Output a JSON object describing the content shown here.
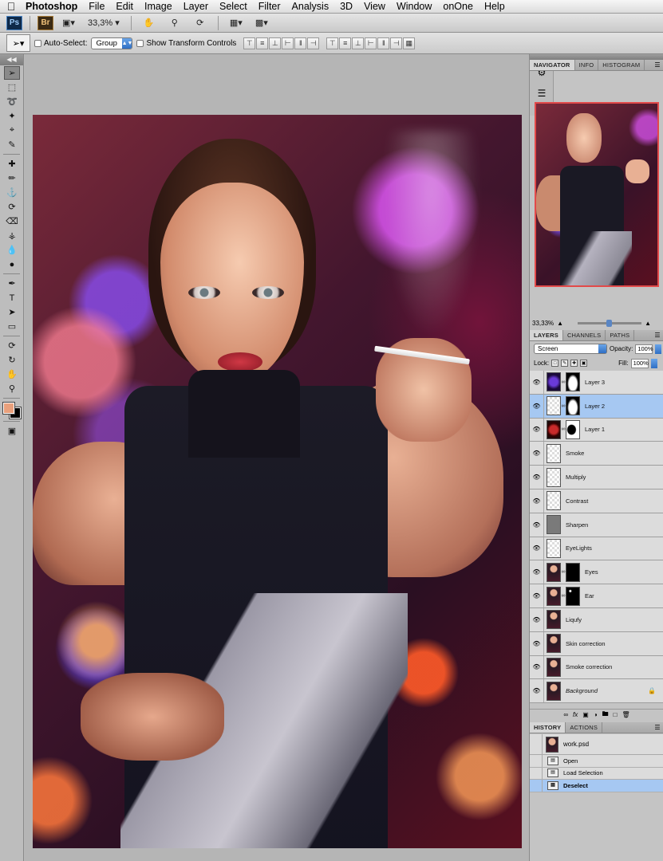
{
  "menubar": {
    "app": "Photoshop",
    "items": [
      "File",
      "Edit",
      "Image",
      "Layer",
      "Select",
      "Filter",
      "Analysis",
      "3D",
      "View",
      "Window",
      "onOne",
      "Help"
    ]
  },
  "appbar": {
    "ps": "Ps",
    "br": "Br",
    "zoom": "33,3%"
  },
  "options": {
    "auto_select_label": "Auto-Select:",
    "auto_select_value": "Group",
    "transform_label": "Show Transform Controls"
  },
  "navigator": {
    "tabs": [
      "NAVIGATOR",
      "INFO",
      "HISTOGRAM"
    ],
    "zoom": "33,33%"
  },
  "layers_panel": {
    "tabs": [
      "LAYERS",
      "CHANNELS",
      "PATHS"
    ],
    "blend_mode": "Screen",
    "opacity_label": "Opacity:",
    "opacity": "100%",
    "lock_label": "Lock:",
    "fill_label": "Fill:",
    "fill": "100%",
    "layers": [
      {
        "name": "Layer 3",
        "thumb": "purple",
        "mask": "bw"
      },
      {
        "name": "Layer 2",
        "thumb": "checker",
        "mask": "bw",
        "selected": true
      },
      {
        "name": "Layer 1",
        "thumb": "dark",
        "mask": "wb"
      },
      {
        "name": "Smoke",
        "thumb": "checker"
      },
      {
        "name": "Multiply",
        "thumb": "checker"
      },
      {
        "name": "Contrast",
        "thumb": "checker"
      },
      {
        "name": "Sharpen",
        "thumb": "grey"
      },
      {
        "name": "EyeLights",
        "thumb": "checker"
      },
      {
        "name": "Eyes",
        "thumb": "photo",
        "mask": "black"
      },
      {
        "name": "Ear",
        "thumb": "photo",
        "mask": "dot"
      },
      {
        "name": "Liqufy",
        "thumb": "photo"
      },
      {
        "name": "Skin correction",
        "thumb": "photo"
      },
      {
        "name": "Smoke correction",
        "thumb": "photo"
      },
      {
        "name": "Background",
        "thumb": "photo",
        "italic": true,
        "locked": true
      }
    ]
  },
  "history_panel": {
    "tabs": [
      "HISTORY",
      "ACTIONS"
    ],
    "snapshot": "work.psd",
    "states": [
      {
        "name": "Open"
      },
      {
        "name": "Load Selection"
      },
      {
        "name": "Deselect",
        "selected": true
      }
    ]
  }
}
